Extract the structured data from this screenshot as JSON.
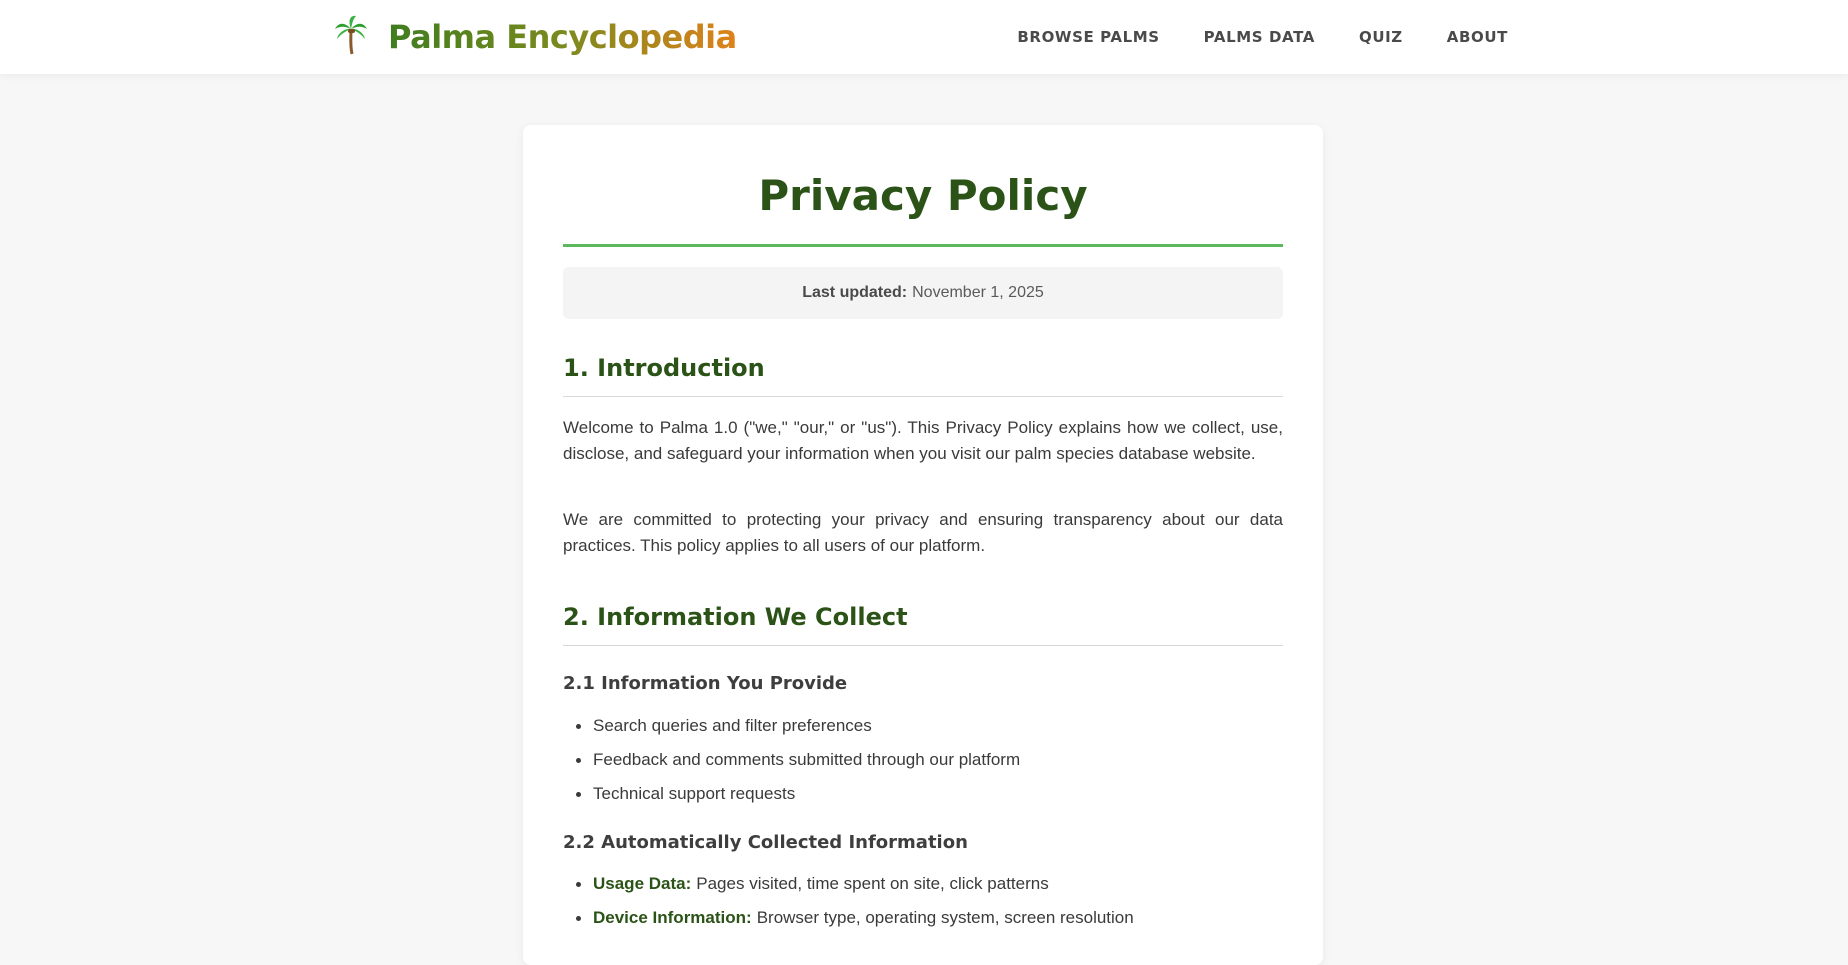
{
  "header": {
    "logo_icon": "palm-tree-icon",
    "brand": "Palma Encyclopedia",
    "nav": [
      {
        "label": "BROWSE PALMS"
      },
      {
        "label": "PALMS DATA"
      },
      {
        "label": "QUIZ"
      },
      {
        "label": "ABOUT"
      }
    ]
  },
  "page": {
    "title": "Privacy Policy",
    "updated_label": "Last updated:",
    "updated_date": "November 1, 2025"
  },
  "sections": {
    "intro": {
      "heading": "1. Introduction",
      "p1": "Welcome to Palma 1.0 (\"we,\" \"our,\" or \"us\"). This Privacy Policy explains how we collect, use, disclose, and safeguard your information when you visit our palm species database website.",
      "p2": "We are committed to protecting your privacy and ensuring transparency about our data practices. This policy applies to all users of our platform."
    },
    "collect": {
      "heading": "2. Information We Collect",
      "provide": {
        "heading": "2.1 Information You Provide",
        "items": [
          "Search queries and filter preferences",
          "Feedback and comments submitted through our platform",
          "Technical support requests"
        ]
      },
      "auto": {
        "heading": "2.2 Automatically Collected Information",
        "items": [
          {
            "key": "Usage Data:",
            "text": "Pages visited, time spent on site, click patterns"
          },
          {
            "key": "Device Information:",
            "text": "Browser type, operating system, screen resolution"
          }
        ]
      }
    }
  },
  "colors": {
    "accent_green": "#2b5317",
    "rule_green": "#5cb85c",
    "brand_gradient_start": "#3f7d1f",
    "brand_gradient_end": "#e0821a"
  }
}
